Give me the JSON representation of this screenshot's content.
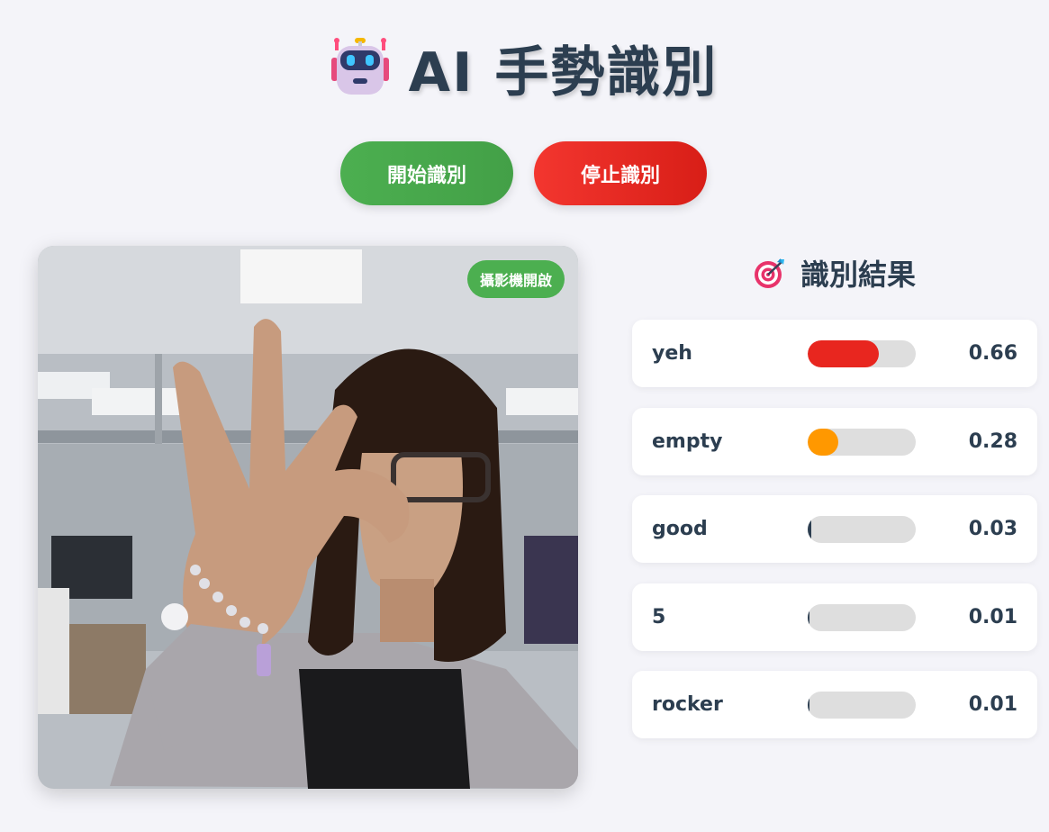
{
  "header": {
    "icon": "robot-icon",
    "title": "AI 手勢識別"
  },
  "controls": {
    "start_label": "開始識別",
    "stop_label": "停止識別",
    "start_color": "#4caf50",
    "stop_color": "#e8261f"
  },
  "camera": {
    "status_badge": "攝影機開啟",
    "badge_color": "#4caf50",
    "feed": "person-making-ok-hand-gesture-in-office"
  },
  "results": {
    "icon": "target-icon",
    "title": "識別結果",
    "items": [
      {
        "label": "yeh",
        "value": "0.66",
        "score": 0.66,
        "color": "#e8261f"
      },
      {
        "label": "empty",
        "value": "0.28",
        "score": 0.28,
        "color": "#ff9800"
      },
      {
        "label": "good",
        "value": "0.03",
        "score": 0.03,
        "color": "#2c3e50"
      },
      {
        "label": "5",
        "value": "0.01",
        "score": 0.01,
        "color": "#2c3e50"
      },
      {
        "label": "rocker",
        "value": "0.01",
        "score": 0.01,
        "color": "#2c3e50"
      }
    ]
  }
}
